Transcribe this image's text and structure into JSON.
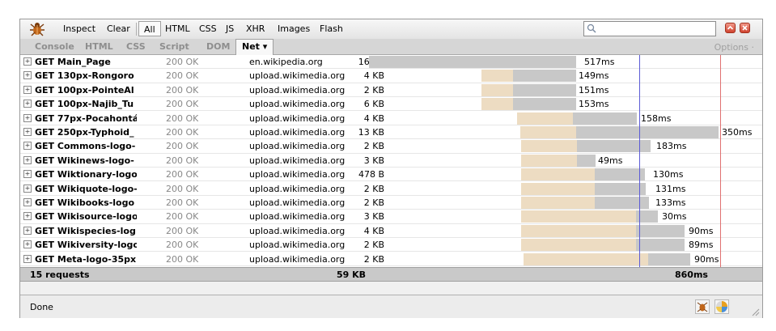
{
  "toolbar": {
    "inspect": "Inspect",
    "clear": "Clear",
    "filters": [
      "All",
      "HTML",
      "CSS",
      "JS",
      "XHR",
      "Images",
      "Flash"
    ],
    "selected_filter": "All",
    "search_value": ""
  },
  "tabs": {
    "items": [
      "Console",
      "HTML",
      "CSS",
      "Script",
      "DOM"
    ],
    "active": "Net ▾",
    "options": "Options ·"
  },
  "requests": [
    {
      "url": "GET Main_Page",
      "status": "200 OK",
      "domain": "en.wikipedia.org",
      "size": "16 KB",
      "time": "517ms"
    },
    {
      "url": "GET 130px-Rongoro",
      "status": "200 OK",
      "domain": "upload.wikimedia.org",
      "size": "4 KB",
      "time": "149ms"
    },
    {
      "url": "GET 100px-PointeAl",
      "status": "200 OK",
      "domain": "upload.wikimedia.org",
      "size": "2 KB",
      "time": "151ms"
    },
    {
      "url": "GET 100px-Najib_Tu",
      "status": "200 OK",
      "domain": "upload.wikimedia.org",
      "size": "6 KB",
      "time": "153ms"
    },
    {
      "url": "GET 77px-Pocahontá",
      "status": "200 OK",
      "domain": "upload.wikimedia.org",
      "size": "4 KB",
      "time": "158ms"
    },
    {
      "url": "GET 250px-Typhoid_",
      "status": "200 OK",
      "domain": "upload.wikimedia.org",
      "size": "13 KB",
      "time": "350ms"
    },
    {
      "url": "GET Commons-logo-",
      "status": "200 OK",
      "domain": "upload.wikimedia.org",
      "size": "2 KB",
      "time": "183ms"
    },
    {
      "url": "GET Wikinews-logo-",
      "status": "200 OK",
      "domain": "upload.wikimedia.org",
      "size": "3 KB",
      "time": "49ms"
    },
    {
      "url": "GET Wiktionary-logo",
      "status": "200 OK",
      "domain": "upload.wikimedia.org",
      "size": "478 B",
      "time": "130ms"
    },
    {
      "url": "GET Wikiquote-logo-",
      "status": "200 OK",
      "domain": "upload.wikimedia.org",
      "size": "2 KB",
      "time": "131ms"
    },
    {
      "url": "GET Wikibooks-logo",
      "status": "200 OK",
      "domain": "upload.wikimedia.org",
      "size": "2 KB",
      "time": "133ms"
    },
    {
      "url": "GET Wikisource-logo",
      "status": "200 OK",
      "domain": "upload.wikimedia.org",
      "size": "3 KB",
      "time": "30ms"
    },
    {
      "url": "GET Wikispecies-log",
      "status": "200 OK",
      "domain": "upload.wikimedia.org",
      "size": "4 KB",
      "time": "90ms"
    },
    {
      "url": "GET Wikiversity-logo",
      "status": "200 OK",
      "domain": "upload.wikimedia.org",
      "size": "2 KB",
      "time": "89ms"
    },
    {
      "url": "GET Meta-logo-35px",
      "status": "200 OK",
      "domain": "upload.wikimedia.org",
      "size": "2 KB",
      "time": "90ms"
    }
  ],
  "summary": {
    "requests": "15 requests",
    "total_size": "59 KB",
    "total_time": "860ms"
  },
  "statusbar": {
    "text": "Done"
  },
  "colors": {
    "wait": "#eddcc2",
    "receive": "#c8c8c8",
    "dom_line": "#5b5bd6",
    "load_line": "#e07070"
  }
}
